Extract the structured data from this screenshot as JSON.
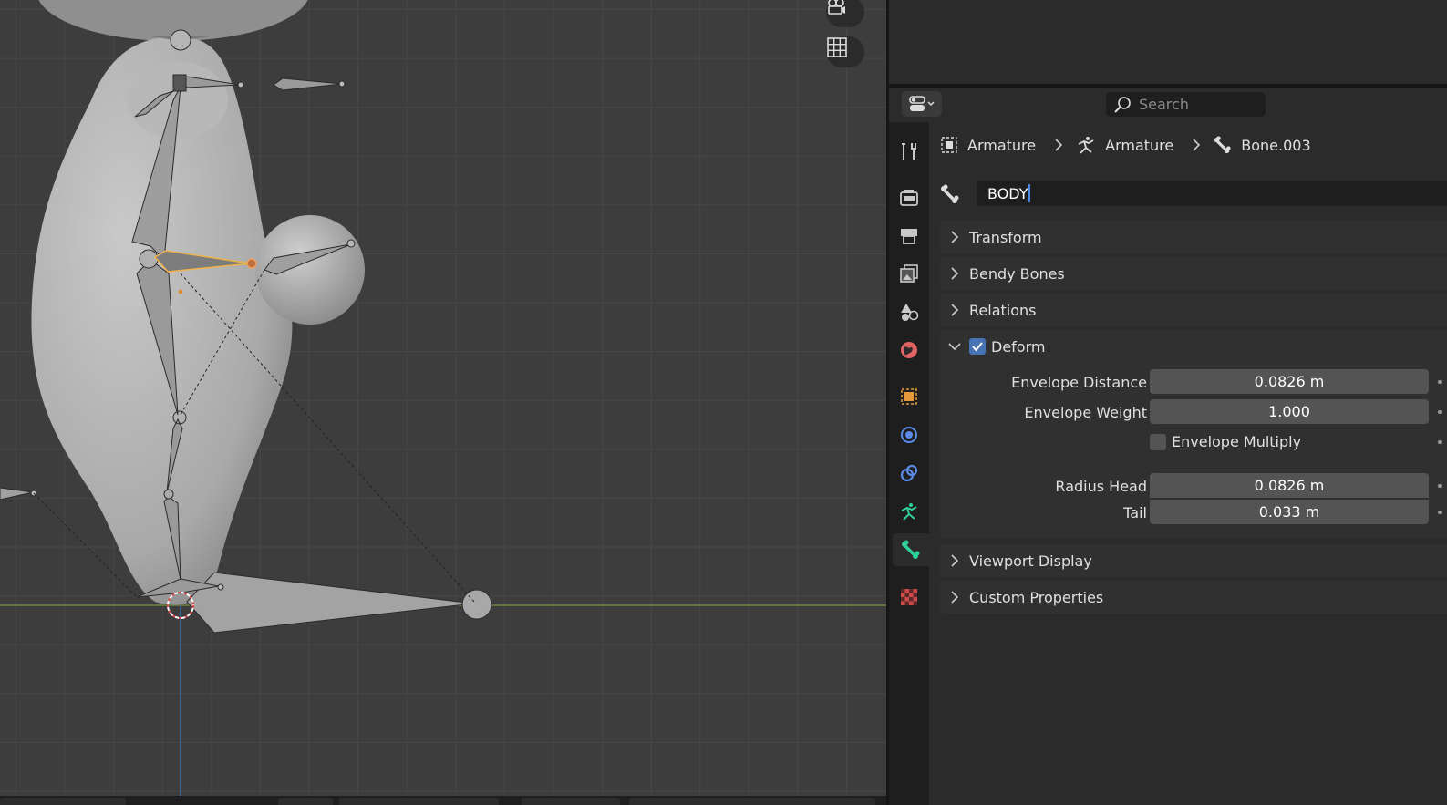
{
  "viewport": {
    "overlay_buttons": [
      "camera-icon",
      "grid-icon"
    ]
  },
  "props": {
    "search_placeholder": "Search",
    "tabs": [
      {
        "name": "tool-icon",
        "color": "#c8c8c8"
      },
      {
        "name": "render-icon",
        "color": "#c8c8c8"
      },
      {
        "name": "output-icon",
        "color": "#c8c8c8"
      },
      {
        "name": "view-layer-icon",
        "color": "#c8c8c8"
      },
      {
        "name": "scene-icon",
        "color": "#c8c8c8"
      },
      {
        "name": "world-icon",
        "color": "#e06262"
      },
      {
        "name": "object-icon",
        "color": "#e69a3c"
      },
      {
        "name": "physics-icon",
        "color": "#5b8ae6"
      },
      {
        "name": "object-constraint-icon",
        "color": "#5b8ae6"
      },
      {
        "name": "armature-data-icon",
        "color": "#2fcf9a"
      },
      {
        "name": "bone-icon",
        "color": "#2fcf9a"
      },
      {
        "name": "texture-icon",
        "color": "#d04a4a"
      }
    ],
    "breadcrumb": {
      "object": "Armature",
      "data": "Armature",
      "bone": "Bone.003"
    },
    "bone_name": "BODY",
    "panels": {
      "transform": "Transform",
      "bendy_bones": "Bendy Bones",
      "relations": "Relations",
      "deform": "Deform",
      "viewport_display": "Viewport Display",
      "custom_properties": "Custom Properties"
    },
    "deform": {
      "checked": true,
      "envelope_distance_label": "Envelope Distance",
      "envelope_distance_value": "0.0826 m",
      "envelope_weight_label": "Envelope Weight",
      "envelope_weight_value": "1.000",
      "envelope_multiply_label": "Envelope Multiply",
      "envelope_multiply_checked": false,
      "radius_head_label": "Radius Head",
      "radius_head_value": "0.0826 m",
      "radius_tail_label": "Tail",
      "radius_tail_value": "0.033 m"
    }
  },
  "colors": {
    "accent_blue": "#4772b3",
    "selected_bone": "#f0b24a",
    "active_tab": "#2fcf9a"
  }
}
